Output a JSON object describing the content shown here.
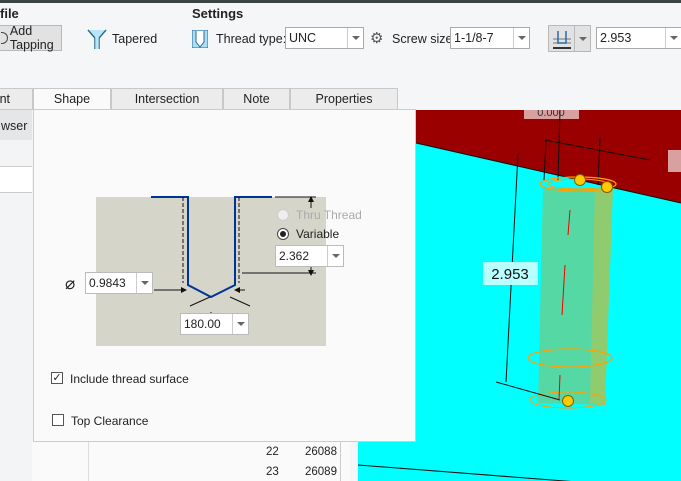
{
  "ribbon": {
    "profile_group": "file",
    "settings_group": "Settings",
    "add_tapping": "Add Tapping",
    "tapered": "Tapered",
    "thread_type_label": "Thread type:",
    "thread_type_value": "UNC",
    "screw_size_label": "Screw size:",
    "screw_size_value": "1-1/8-7",
    "depth_value": "2.953"
  },
  "tabs": [
    {
      "label": "nt"
    },
    {
      "label": "Shape"
    },
    {
      "label": "Intersection"
    },
    {
      "label": "Note"
    },
    {
      "label": "Properties"
    }
  ],
  "browser": {
    "header": "wser",
    "rows": [
      {
        "num": "22",
        "id": "26088"
      },
      {
        "num": "23",
        "id": "26089"
      }
    ]
  },
  "shape": {
    "diameter": "0.9843",
    "angle": "180.00",
    "thru_thread": "Thru Thread",
    "variable": "Variable",
    "depth": "2.362",
    "include_thread_surface": "Include thread surface",
    "top_clearance": "Top Clearance"
  },
  "viewport": {
    "depth_dim": "2.953",
    "top_dim": "0.000"
  },
  "colors": {
    "accent": "#003399",
    "red_surface": "#9a0000",
    "cyan_surface": "#00ffff"
  }
}
